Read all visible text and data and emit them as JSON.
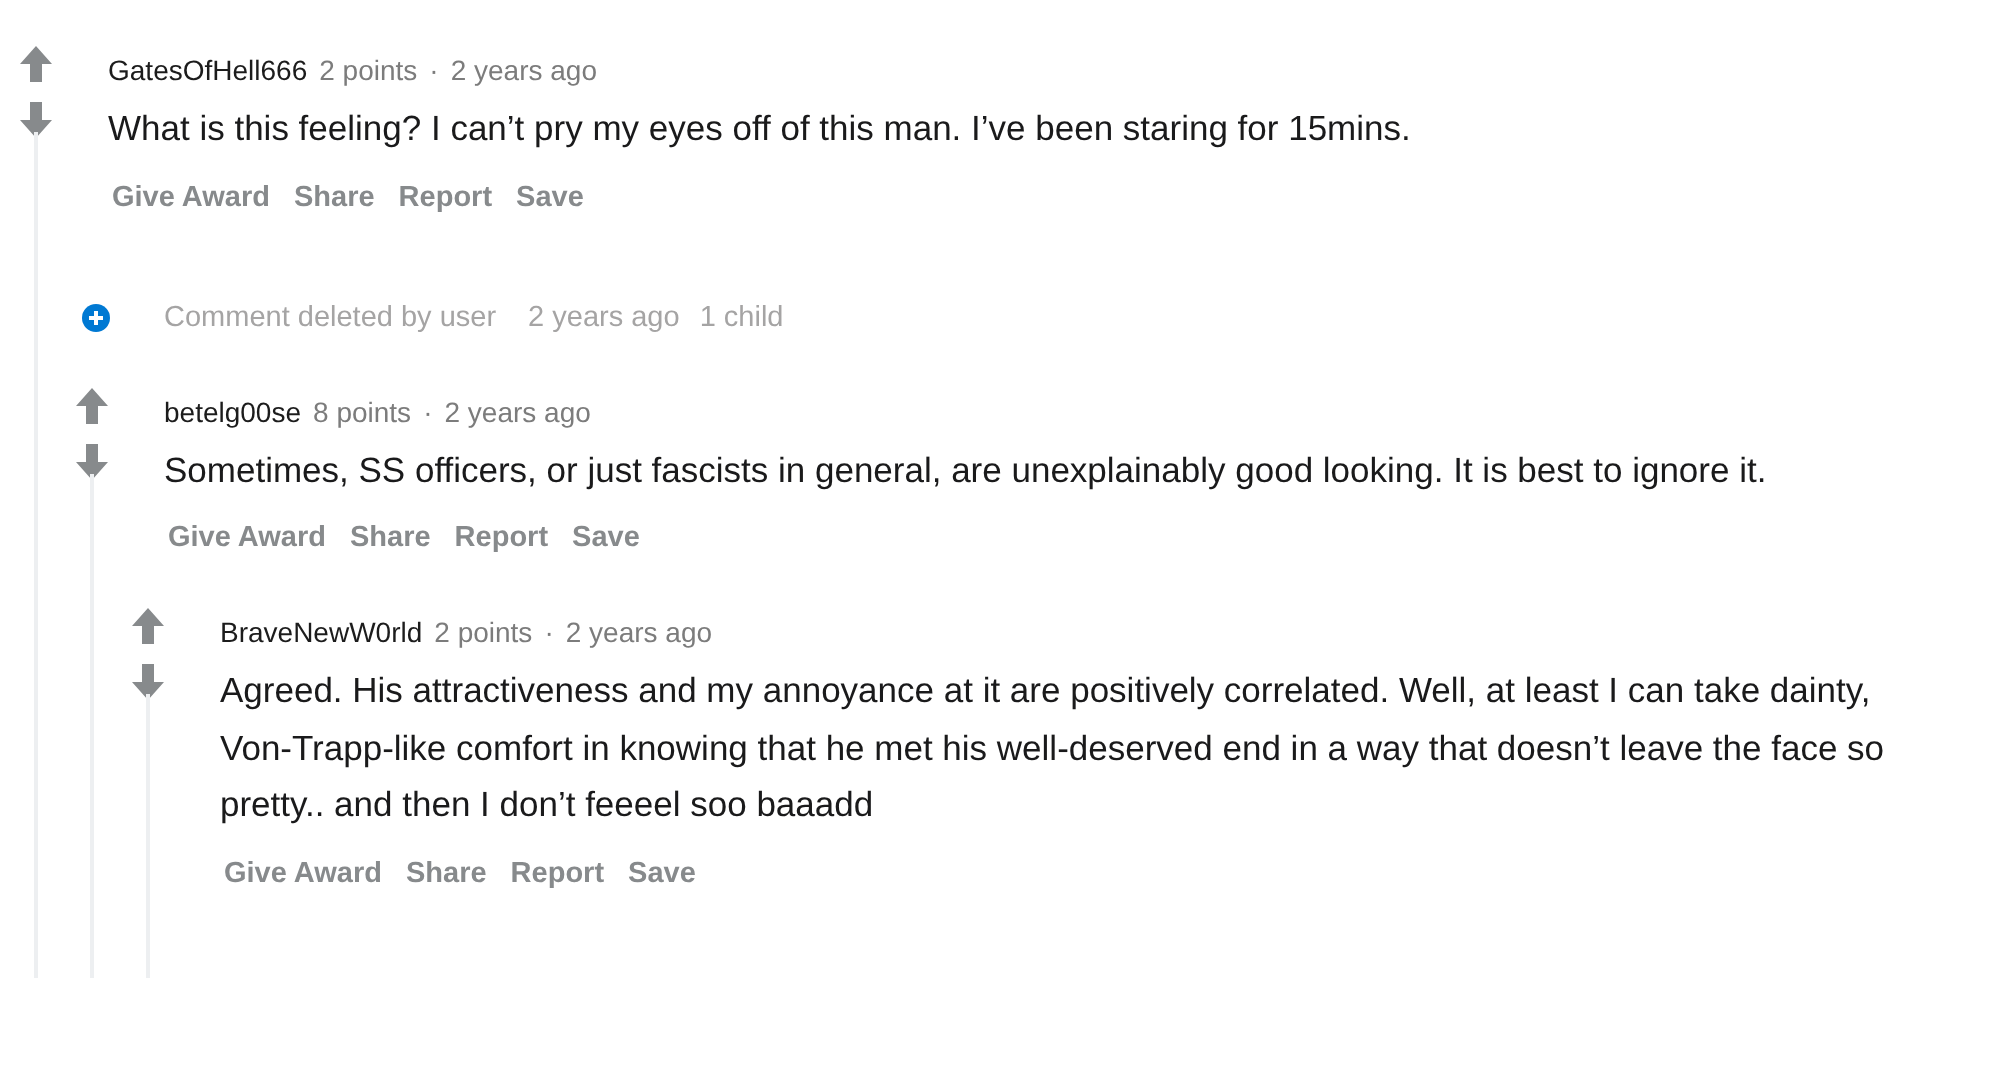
{
  "comments": [
    {
      "kind": "comment",
      "author": "GatesOfHell666",
      "points": "2 points",
      "dot": "·",
      "time": "2 years ago",
      "body": [
        "What is this feeling? I can’t pry my eyes off of this man. I’ve been staring for 15mins."
      ],
      "actions": [
        "Give Award",
        "Share",
        "Report",
        "Save"
      ],
      "children": [
        {
          "kind": "deleted",
          "text": "Comment deleted by user",
          "time": "2 years ago",
          "child_count": "1 child"
        },
        {
          "kind": "comment",
          "author": "betelg00se",
          "points": "8 points",
          "dot": "·",
          "time": "2 years ago",
          "body": [
            "Sometimes, SS officers, or just fascists in general, are unexplainably good looking. It is best to ignore it."
          ],
          "actions": [
            "Give Award",
            "Share",
            "Report",
            "Save"
          ],
          "children": [
            {
              "kind": "comment",
              "author": "BraveNewW0rld",
              "points": "2 points",
              "dot": "·",
              "time": "2 years ago",
              "body": [
                "Agreed. His attractiveness and my annoyance at it are positively correlated. Well, at least I can take dainty, Von-Trapp-like comfort in knowing that he met his well-deserved end in a way that doesn’t leave the face so pretty.. and then I don’t feeeel soo baaadd"
              ],
              "actions": [
                "Give Award",
                "Share",
                "Report",
                "Save"
              ]
            }
          ]
        }
      ]
    }
  ]
}
